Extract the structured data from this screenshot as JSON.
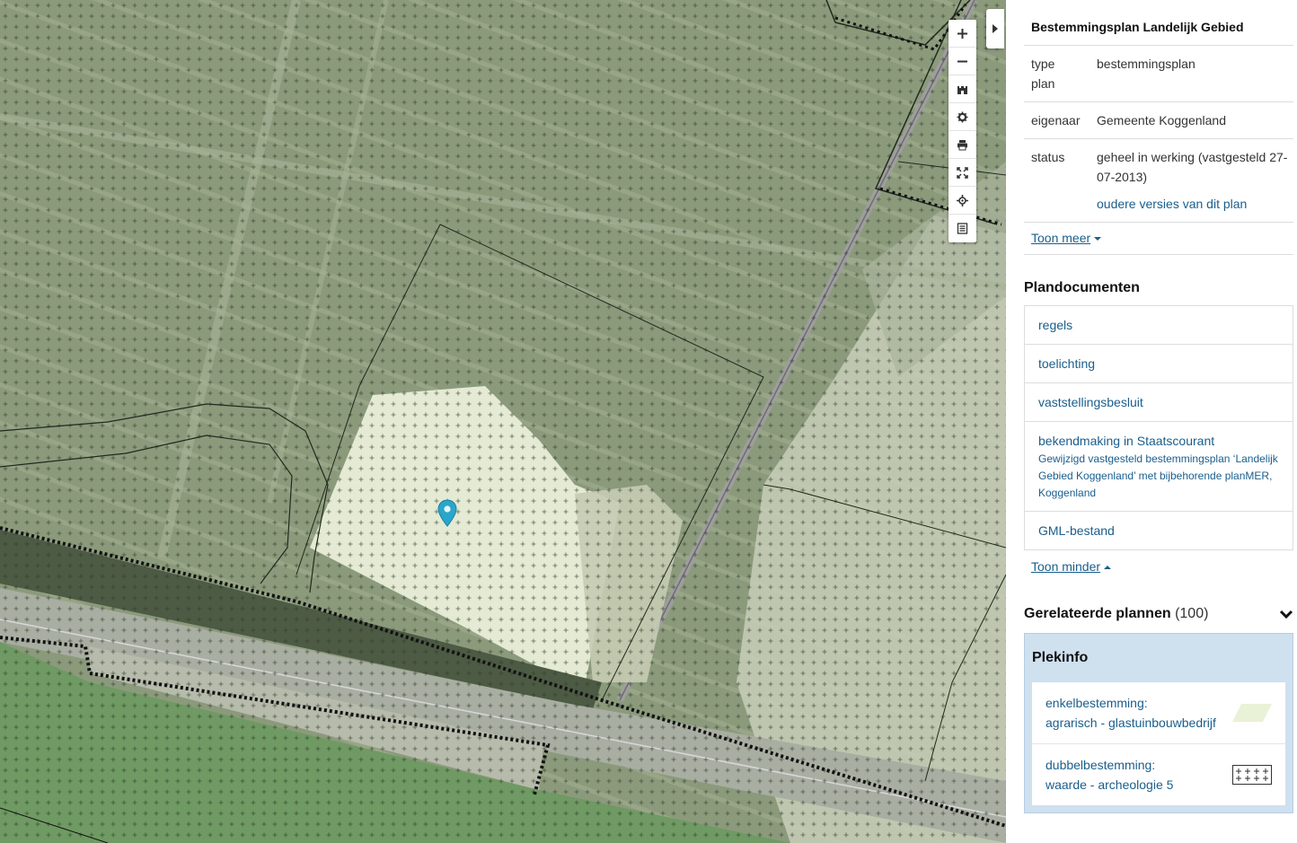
{
  "map": {
    "toolbar": [
      {
        "name": "zoom-in-button",
        "icon": "plus-icon"
      },
      {
        "name": "zoom-out-button",
        "icon": "minus-icon"
      },
      {
        "name": "layers-button",
        "icon": "castle-icon"
      },
      {
        "name": "settings-button",
        "icon": "gear-icon"
      },
      {
        "name": "print-button",
        "icon": "printer-icon"
      },
      {
        "name": "fullscreen-button",
        "icon": "expand-icon"
      },
      {
        "name": "locate-button",
        "icon": "crosshair-icon"
      },
      {
        "name": "legend-button",
        "icon": "list-icon"
      }
    ],
    "pin_color": "#2ba6cb"
  },
  "plan": {
    "title": "Bestemmingsplan Landelijk Gebied",
    "type_label": "type plan",
    "type_value": "bestemmingsplan",
    "owner_label": "eigenaar",
    "owner_value": "Gemeente Koggenland",
    "status_label": "status",
    "status_value": "geheel in werking (vastgesteld 27-07-2013)",
    "older_versions_link": "oudere versies van dit plan",
    "show_more": "Toon meer"
  },
  "documents": {
    "title": "Plandocumenten",
    "items": [
      {
        "label": "regels"
      },
      {
        "label": "toelichting"
      },
      {
        "label": "vaststellingsbesluit"
      },
      {
        "label": "bekendmaking in Staatscourant",
        "sub": "Gewijzigd vastgesteld bestemmingsplan ‘Landelijk Gebied Koggenland’ met bijbehorende planMER, Koggenland"
      },
      {
        "label": "GML-bestand"
      }
    ],
    "show_less": "Toon minder"
  },
  "related": {
    "title": "Gerelateerde plannen",
    "count": "(100)"
  },
  "plekinfo": {
    "title": "Plekinfo",
    "items": [
      {
        "line1": "enkelbestemming:",
        "line2": "agrarisch - glastuinbouwbedrijf",
        "swatch_color": "#e9f2d7"
      },
      {
        "line1": "dubbelbestemming:",
        "line2": "waarde - archeologie 5"
      }
    ]
  },
  "colors": {
    "link": "#1a5e8c",
    "plekinfo_bg": "#cfe0ef"
  }
}
